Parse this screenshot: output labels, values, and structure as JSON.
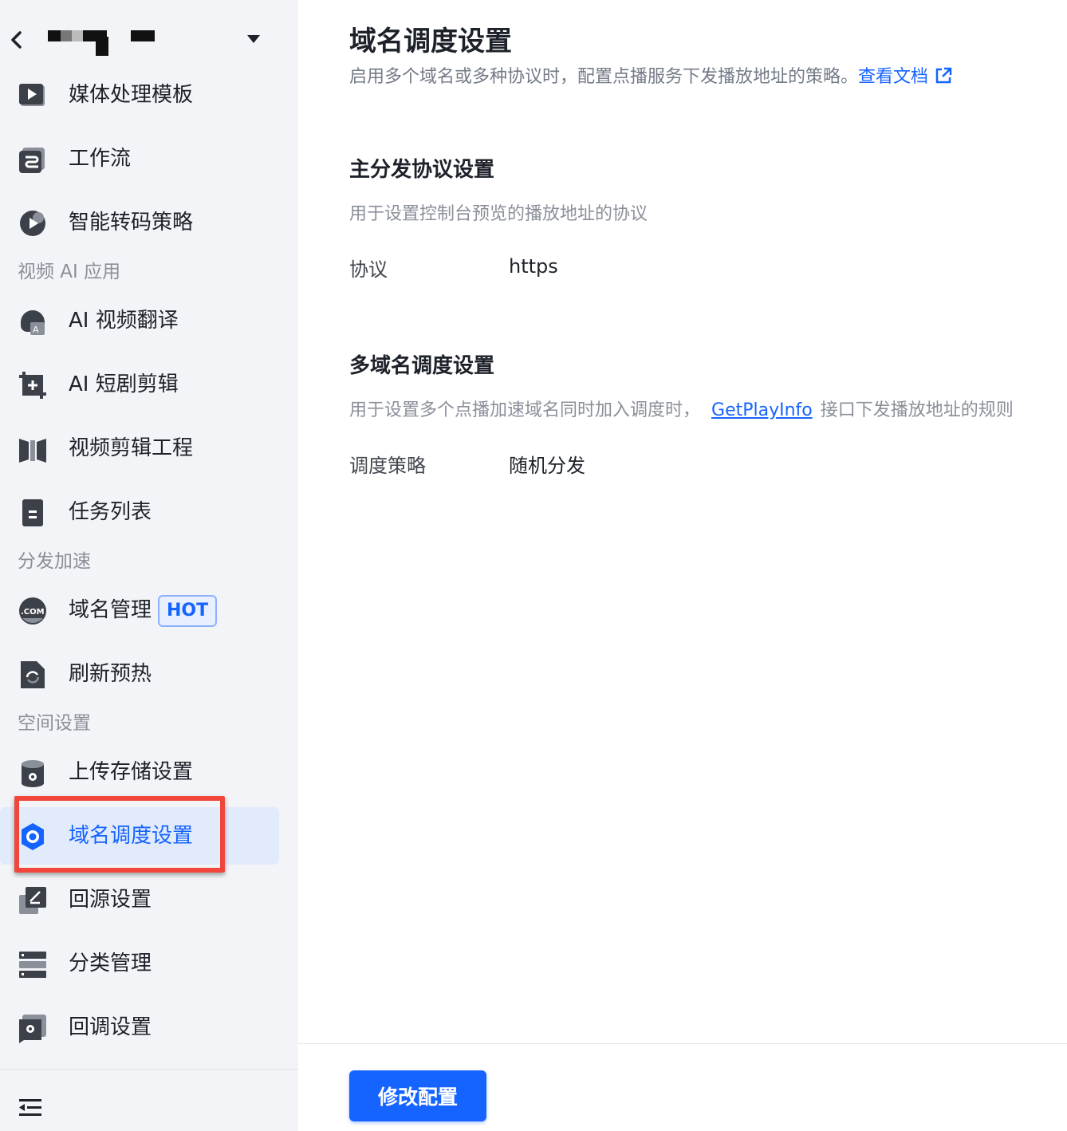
{
  "sidebar": {
    "header": {
      "back_icon": "chevron-left-icon",
      "dropdown_icon": "caret-down-icon"
    },
    "items": [
      {
        "label": "媒体处理模板",
        "icon": "play-template-icon"
      },
      {
        "label": "工作流",
        "icon": "workflow-icon"
      },
      {
        "label": "智能转码策略",
        "icon": "smart-transcode-icon"
      },
      {
        "group": "视频 AI 应用"
      },
      {
        "label": "AI 视频翻译",
        "icon": "translate-icon"
      },
      {
        "label": "AI 短剧剪辑",
        "icon": "crop-add-icon"
      },
      {
        "label": "视频剪辑工程",
        "icon": "film-icon"
      },
      {
        "label": "任务列表",
        "icon": "clipboard-icon"
      },
      {
        "group": "分发加速"
      },
      {
        "label": "域名管理",
        "icon": "dotcom-icon",
        "badge": "HOT"
      },
      {
        "label": "刷新预热",
        "icon": "refresh-doc-icon"
      },
      {
        "group": "空间设置"
      },
      {
        "label": "上传存储设置",
        "icon": "storage-gear-icon"
      },
      {
        "label": "域名调度设置",
        "icon": "gear-icon",
        "active": true
      },
      {
        "label": "回源设置",
        "icon": "edit-stack-icon"
      },
      {
        "label": "分类管理",
        "icon": "list-stack-icon"
      },
      {
        "label": "回调设置",
        "icon": "callback-gear-icon"
      }
    ]
  },
  "main": {
    "title": "域名调度设置",
    "description": "启用多个域名或多种协议时，配置点播服务下发播放地址的策略。",
    "doc_link": "查看文档",
    "sections": [
      {
        "title": "主分发协议设置",
        "description": "用于设置控制台预览的播放地址的协议",
        "field_label": "协议",
        "field_value": "https"
      },
      {
        "title": "多域名调度设置",
        "description_prefix": "用于设置多个点播加速域名同时加入调度时，",
        "api_link": "GetPlayInfo",
        "description_suffix": "接口下发播放地址的规则",
        "field_label": "调度策略",
        "field_value": "随机分发"
      }
    ],
    "primary_button": "修改配置"
  },
  "colors": {
    "accent": "#1664ff",
    "sidebar_bg": "#f3f4f7",
    "highlight": "#f0463c",
    "active_bg": "#e2ebfb"
  }
}
